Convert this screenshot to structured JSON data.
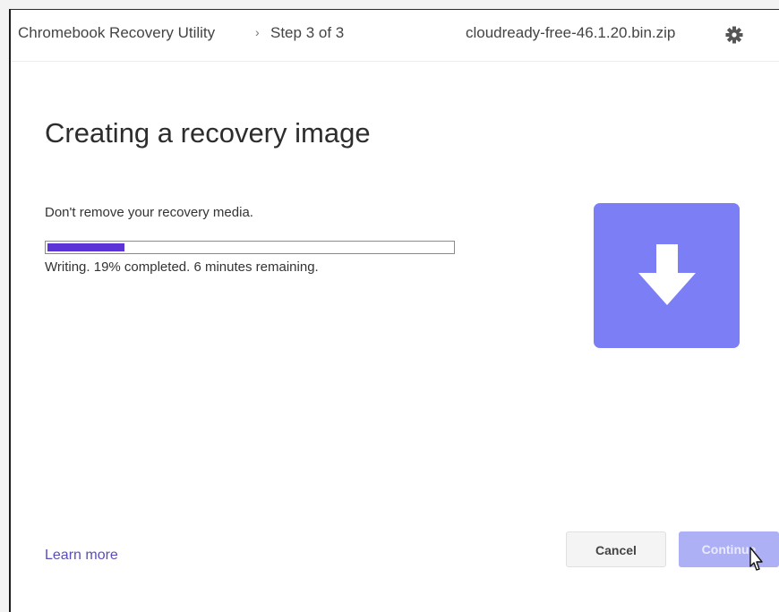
{
  "header": {
    "app_title": "Chromebook Recovery Utility",
    "separator": "›",
    "step": "Step 3 of 3",
    "file_name": "cloudready-free-46.1.20.bin.zip",
    "settings_icon": "gear-icon"
  },
  "main": {
    "title": "Creating a recovery image",
    "instruction": "Don't remove your recovery media.",
    "progress_percent": 19,
    "status": "Writing. 19% completed. 6 minutes remaining.",
    "tile_icon": "download-arrow-icon",
    "tile_color": "#7b7ef5",
    "progress_color": "#5b33d6"
  },
  "footer": {
    "learn_more": "Learn more",
    "cancel_label": "Cancel",
    "continue_label": "Continue",
    "continue_disabled": true
  }
}
